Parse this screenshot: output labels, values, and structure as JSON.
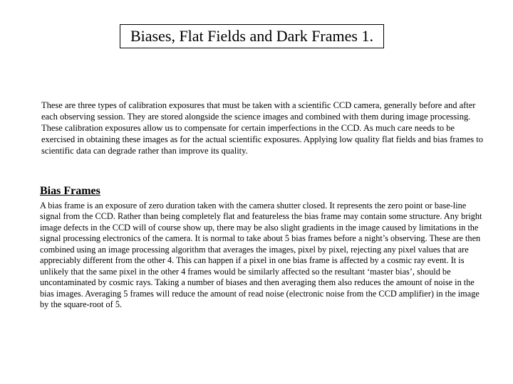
{
  "title": "Biases, Flat Fields and Dark Frames 1.",
  "intro": "These are three types of calibration exposures that must be taken with a scientific CCD camera, generally before and after each observing session. They are stored alongside the science images and combined with them during image processing. These calibration exposures allow us to compensate for certain imperfections in the CCD. As much care needs to be exercised in obtaining these images as for the actual scientific exposures. Applying low quality flat fields and bias frames to scientific data can degrade rather than improve its quality.",
  "subhead": "Bias Frames",
  "body2": "A bias frame is an exposure of zero duration taken with the camera shutter closed. It represents the zero point or base-line signal from the CCD. Rather than being completely flat and featureless the bias frame may contain some structure. Any bright image defects in the CCD will of course show up, there may be also slight gradients in the image caused by limitations in the signal processing electronics of the camera. It is normal to take about 5 bias frames before a night’s observing. These are then combined using an image processing algorithm that averages the images, pixel by pixel, rejecting any pixel values that are appreciably different from the other 4. This can happen if a pixel in one bias frame is affected by a cosmic ray event. It is unlikely that the same pixel in the other 4 frames would be similarly affected so the resultant ‘master bias’, should be uncontaminated by cosmic rays. Taking a number of biases and then averaging them also reduces the amount of noise in the bias images. Averaging 5 frames will reduce the amount of read noise (electronic noise from the CCD amplifier) in the image by the square-root of 5."
}
